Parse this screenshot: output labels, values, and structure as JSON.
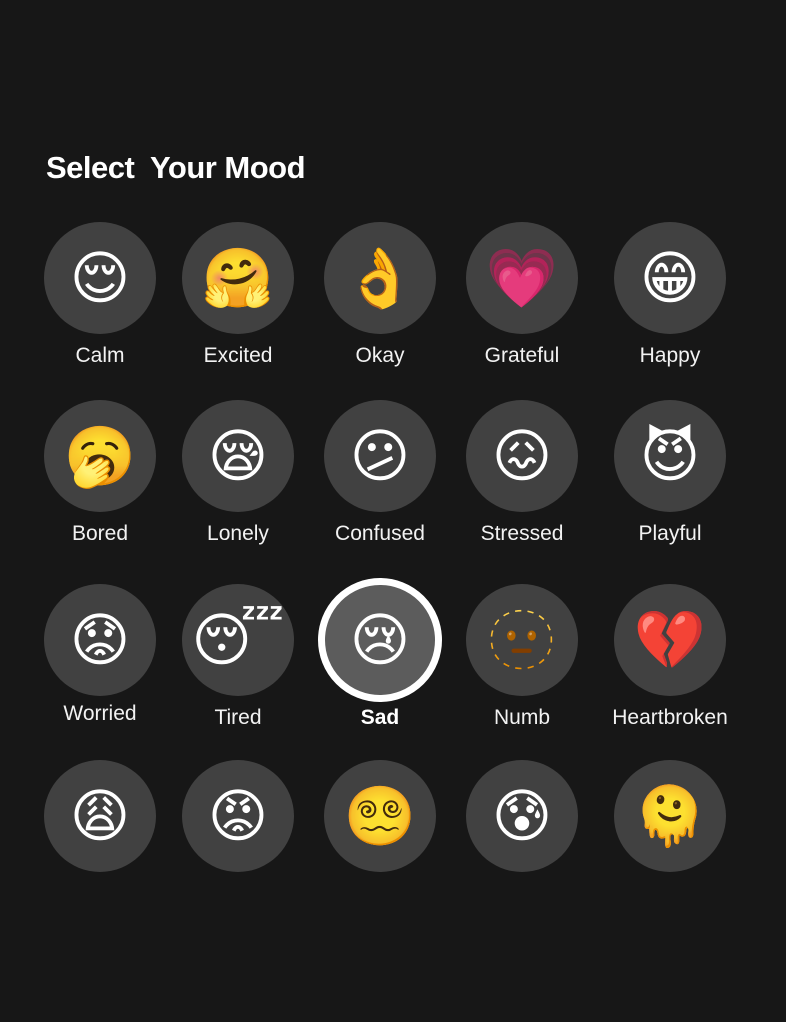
{
  "title": "Select  Your Mood",
  "selected_mood": "Sad",
  "moods": [
    {
      "label": "Calm",
      "emoji": "😌",
      "icon": "relieved-face-icon"
    },
    {
      "label": "Excited",
      "emoji": "🤗",
      "icon": "hugging-face-icon"
    },
    {
      "label": "Okay",
      "emoji": "👌",
      "icon": "ok-hand-icon"
    },
    {
      "label": "Grateful",
      "emoji": "💗",
      "icon": "growing-heart-icon"
    },
    {
      "label": "Happy",
      "emoji": "😁",
      "icon": "beaming-face-icon"
    },
    {
      "label": "Bored",
      "emoji": "🥱",
      "icon": "yawning-face-icon"
    },
    {
      "label": "Lonely",
      "emoji": "😪",
      "icon": "sleepy-face-icon"
    },
    {
      "label": "Confused",
      "emoji": "😕",
      "icon": "confused-face-icon"
    },
    {
      "label": "Stressed",
      "emoji": "😖",
      "icon": "confounded-face-icon"
    },
    {
      "label": "Playful",
      "emoji": "😈",
      "icon": "smiling-devil-icon"
    },
    {
      "label": "Worried",
      "emoji": "😟",
      "icon": "worried-face-icon"
    },
    {
      "label": "Tired",
      "emoji": "😴",
      "icon": "sleeping-face-icon"
    },
    {
      "label": "Sad",
      "emoji": "😢",
      "icon": "crying-face-icon"
    },
    {
      "label": "Numb",
      "emoji": "🫥",
      "icon": "dotted-line-face-icon"
    },
    {
      "label": "Heartbroken",
      "emoji": "💔",
      "icon": "broken-heart-icon"
    },
    {
      "label": "",
      "emoji": "😩",
      "icon": "weary-face-icon"
    },
    {
      "label": "",
      "emoji": "😡",
      "icon": "angry-face-icon"
    },
    {
      "label": "",
      "emoji": "😵‍💫",
      "icon": "dizzy-face-icon"
    },
    {
      "label": "",
      "emoji": "😰",
      "icon": "anxious-face-icon"
    },
    {
      "label": "",
      "emoji": "🫠",
      "icon": "melting-face-icon"
    }
  ]
}
